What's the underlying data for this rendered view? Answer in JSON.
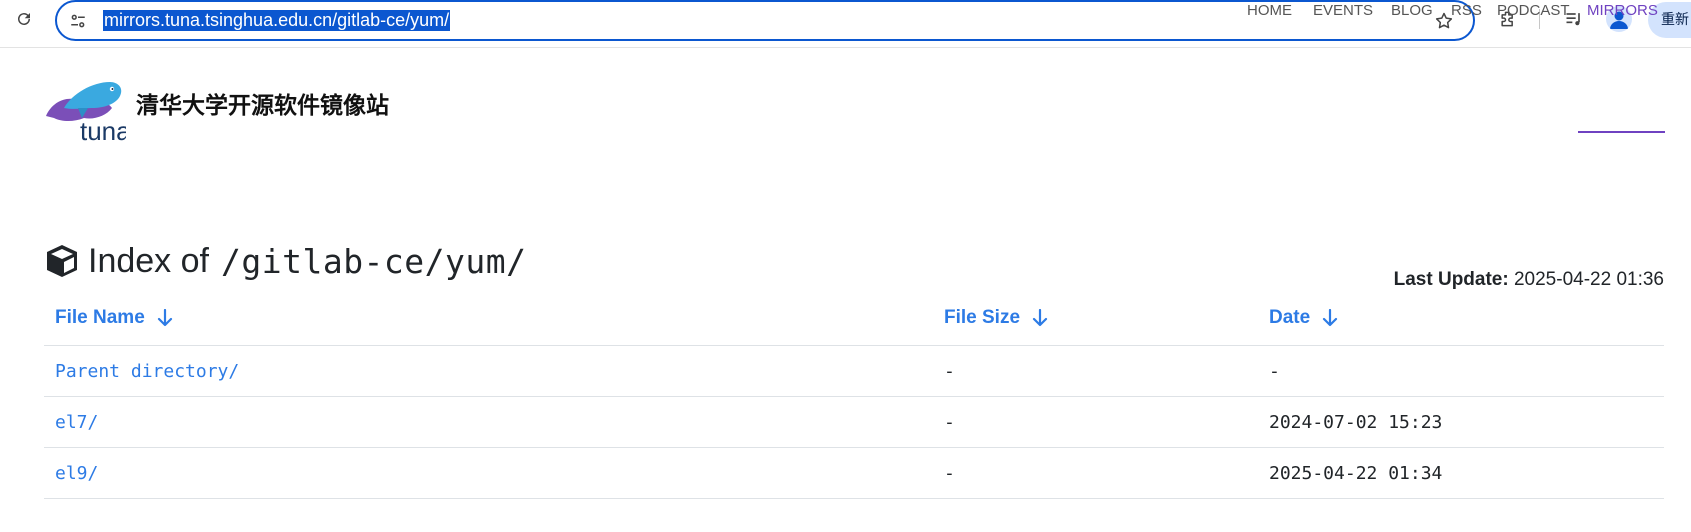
{
  "browser": {
    "url": "mirrors.tuna.tsinghua.edu.cn/gitlab-ce/yum/",
    "update_button_label": "重新"
  },
  "site": {
    "logo_text": "tuna",
    "title": "清华大学开源软件镜像站",
    "nav": [
      {
        "label": "HOME",
        "active": false
      },
      {
        "label": "EVENTS",
        "active": false
      },
      {
        "label": "BLOG",
        "active": false
      },
      {
        "label": "RSS",
        "active": false
      },
      {
        "label": "PODCAST",
        "active": false
      },
      {
        "label": "MIRRORS",
        "active": true
      }
    ],
    "accent_color": "#6f42c1",
    "link_color": "#2d7be5"
  },
  "page": {
    "title_prefix": "Index of",
    "title_path": "/gitlab-ce/yum/",
    "last_update_label": "Last Update:",
    "last_update_value": "2025-04-22 01:36"
  },
  "listing": {
    "columns": [
      {
        "label": "File Name",
        "sort_icon": "arrow-down-icon"
      },
      {
        "label": "File Size",
        "sort_icon": "arrow-down-icon"
      },
      {
        "label": "Date",
        "sort_icon": "arrow-down-icon"
      }
    ],
    "rows": [
      {
        "name": "Parent directory/",
        "size": "-",
        "date": "-"
      },
      {
        "name": "el7/",
        "size": "-",
        "date": "2024-07-02 15:23"
      },
      {
        "name": "el9/",
        "size": "-",
        "date": "2025-04-22 01:34"
      }
    ]
  }
}
